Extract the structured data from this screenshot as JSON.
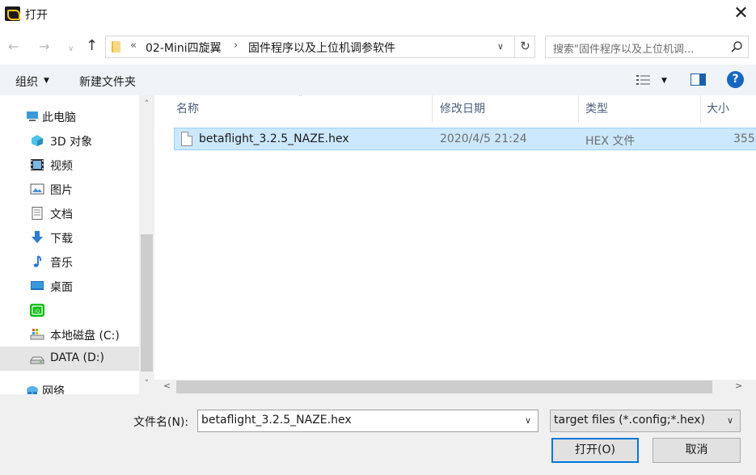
{
  "window": {
    "title": "打开",
    "close_glyph": "✕"
  },
  "nav": {
    "back_glyph": "←",
    "forward_glyph": "→",
    "recent_glyph": "∨",
    "up_glyph": "↑",
    "breadcrumb_overflow": "«",
    "breadcrumb": [
      "02-Mini四旋翼",
      "固件程序以及上位机调参软件"
    ],
    "breadcrumb_sep": "›",
    "dropdown_glyph": "∨",
    "refresh_glyph": "↻",
    "search_placeholder": "搜索\"固件程序以及上位机调..."
  },
  "toolbar": {
    "organize": "组织",
    "organize_caret": "▼",
    "new_folder": "新建文件夹",
    "view_caret": "▼",
    "help": "?"
  },
  "sidebar": {
    "items": [
      {
        "label": "此电脑",
        "icon": "computer-icon"
      },
      {
        "label": "3D 对象",
        "icon": "3d-objects-icon"
      },
      {
        "label": "视频",
        "icon": "video-icon"
      },
      {
        "label": "图片",
        "icon": "pictures-icon"
      },
      {
        "label": "文档",
        "icon": "documents-icon"
      },
      {
        "label": "下载",
        "icon": "downloads-icon"
      },
      {
        "label": "音乐",
        "icon": "music-icon"
      },
      {
        "label": "桌面",
        "icon": "desktop-icon"
      },
      {
        "label": "",
        "icon": "iqiyi-icon"
      },
      {
        "label": "本地磁盘 (C:)",
        "icon": "drive-c-icon"
      },
      {
        "label": "DATA (D:)",
        "icon": "drive-d-icon",
        "selected": true
      },
      {
        "label": "网络",
        "icon": "network-icon"
      }
    ],
    "scroll_up": "˄",
    "scroll_down": "˅"
  },
  "columns": {
    "name": "名称",
    "modified": "修改日期",
    "type": "类型",
    "size": "大小",
    "sort_caret": "˄"
  },
  "files": [
    {
      "name": "betaflight_3.2.5_NAZE.hex",
      "modified": "2020/4/5 21:24",
      "type": "HEX 文件",
      "size": "355"
    }
  ],
  "hscroll": {
    "left": "<",
    "right": ">"
  },
  "footer": {
    "filename_label": "文件名(N):",
    "filename_value": "betaflight_3.2.5_NAZE.hex",
    "filter_value": "target files (*.config;*.hex)",
    "dropdown_glyph": "∨",
    "open_button": "打开(O)",
    "cancel_button": "取消"
  },
  "colors": {
    "accent": "#0078d7",
    "selection": "#cce8ff",
    "toolbar_bg": "#f0f4f9",
    "help_icon": "#1866c4"
  }
}
